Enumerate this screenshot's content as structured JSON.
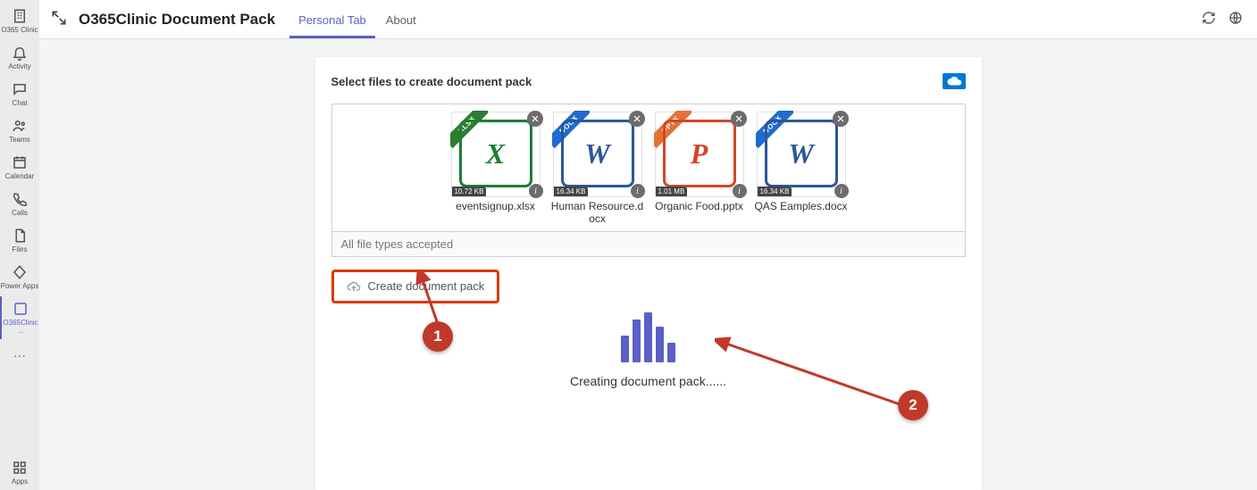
{
  "rail": {
    "items": [
      {
        "id": "o365clinic",
        "label": "O365 Clinic"
      },
      {
        "id": "activity",
        "label": "Activity"
      },
      {
        "id": "chat",
        "label": "Chat"
      },
      {
        "id": "teams",
        "label": "Teams"
      },
      {
        "id": "calendar",
        "label": "Calendar"
      },
      {
        "id": "calls",
        "label": "Calls"
      },
      {
        "id": "files",
        "label": "Files"
      },
      {
        "id": "powerapps",
        "label": "Power Apps"
      },
      {
        "id": "o365clinic2",
        "label": "O365Clinic ..."
      }
    ],
    "bottom": {
      "apps": "Apps"
    }
  },
  "header": {
    "title": "O365Clinic Document Pack",
    "tabs": [
      {
        "id": "personal",
        "label": "Personal Tab",
        "active": true
      },
      {
        "id": "about",
        "label": "About",
        "active": false
      }
    ]
  },
  "card": {
    "title": "Select files to create document pack",
    "dropzone_footer": "All file types accepted",
    "create_label": "Create document pack",
    "progress_label": "Creating document pack......"
  },
  "files": [
    {
      "name": "eventsignup.xlsx",
      "size": "10.72 KB",
      "ext": "XLSX",
      "color": "#1e7e34",
      "ribbon": "#2e7d32",
      "letter": "X"
    },
    {
      "name": "Human Resource.docx",
      "size": "16.34 KB",
      "ext": "DOCX",
      "color": "#2b579a",
      "ribbon": "#1f6bd0",
      "letter": "W"
    },
    {
      "name": "Organic Food.pptx",
      "size": "1.01 MB",
      "ext": "PPTX",
      "color": "#d24726",
      "ribbon": "#e37236",
      "letter": "P"
    },
    {
      "name": "QAS Eamples.docx",
      "size": "16.34 KB",
      "ext": "DOCX",
      "color": "#2b579a",
      "ribbon": "#1f6bd0",
      "letter": "W"
    }
  ],
  "callouts": {
    "1": "1",
    "2": "2"
  }
}
